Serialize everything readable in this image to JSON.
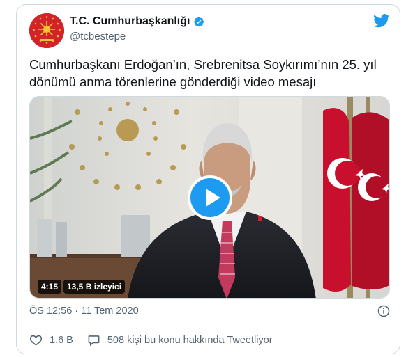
{
  "account": {
    "name": "T.C. Cumhurbaşkanlığı",
    "handle": "@tcbestepe"
  },
  "tweet": {
    "text": "Cumhurbaşkanı Erdoğan’ın, Srebrenitsa Soykırımı’nın 25. yıl dönümü anma törenlerine gönderdiği video mesajı",
    "timestamp": "ÖS 12:56 · 11 Tem 2020"
  },
  "video": {
    "duration": "4:15",
    "views": "13,5 B izleyici"
  },
  "actions": {
    "likes": "1,6 B",
    "discussion": "508 kişi bu konu hakkında Tweetliyor"
  },
  "colors": {
    "accent": "#1d9bf0",
    "seal_red": "#d2232a",
    "seal_gold": "#f2c230",
    "flag_red": "#c8102e"
  },
  "icons": [
    "verified-badge-icon",
    "twitter-bird-icon",
    "play-icon",
    "info-icon",
    "heart-icon",
    "speech-bubble-icon"
  ]
}
